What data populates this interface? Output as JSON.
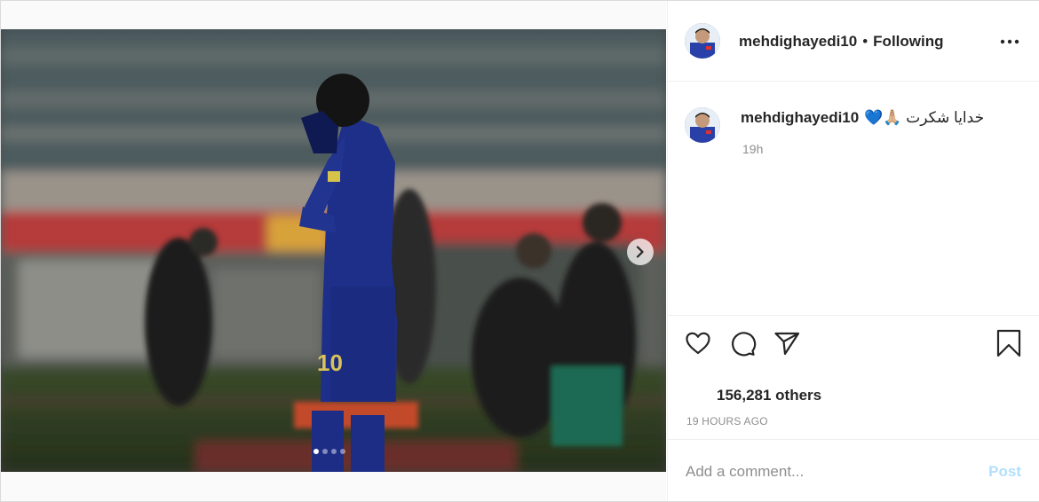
{
  "post": {
    "username": "mehdighayedi10",
    "separator": "•",
    "follow_status": "Following",
    "caption_user": "mehdighayedi10",
    "caption_text": "خدایا شکرت 🙏🏼💙",
    "caption_time": "19h",
    "likes_text": "156,281 others",
    "posted_ago": "19 HOURS AGO",
    "carousel": {
      "total": 4,
      "active": 1
    }
  },
  "comment_box": {
    "placeholder": "Add a comment...",
    "post_label": "Post"
  },
  "icons": {
    "like": "heart-icon",
    "comment": "comment-icon",
    "share": "send-icon",
    "save": "bookmark-icon",
    "more": "more-options-icon",
    "next": "chevron-right-icon"
  },
  "colors": {
    "post_disabled": "#b2dffc",
    "jersey": "#1e2f8a",
    "secondary_text": "#8e8e8e"
  }
}
